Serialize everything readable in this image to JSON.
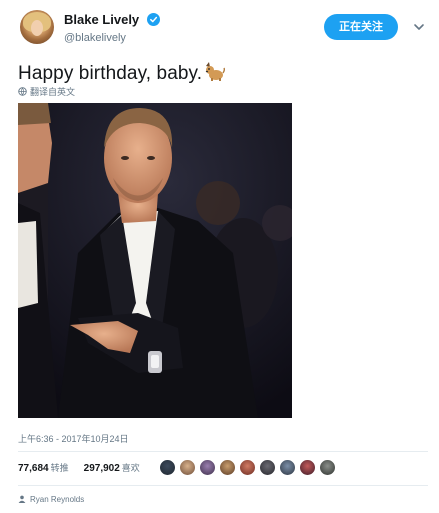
{
  "header": {
    "display_name": "Blake Lively",
    "handle": "@blakelively",
    "follow_button_label": "正在关注",
    "verified_icon": "verified-badge-icon",
    "menu_icon": "chevron-down-icon"
  },
  "tweet": {
    "text": "Happy birthday, baby.",
    "translate_label": "翻译自英文",
    "timestamp": "上午6:36 - 2017年10月24日"
  },
  "stats": {
    "retweets_count": "77,684",
    "retweets_label": "转推",
    "likes_count": "297,902",
    "likes_label": "喜欢",
    "liker_avatar_count": 9
  },
  "footer": {
    "reply_name": "Ryan Reynolds"
  },
  "colors": {
    "accent": "#1da1f2",
    "text_primary": "#14171a",
    "text_secondary": "#657786",
    "divider": "#e6ecf0"
  }
}
